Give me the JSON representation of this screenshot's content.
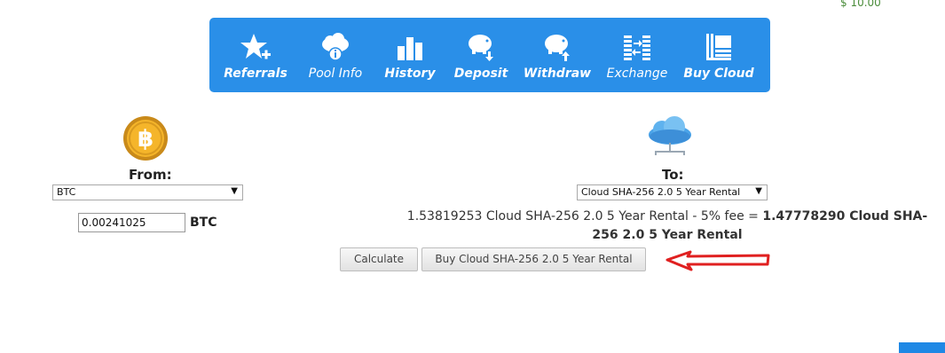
{
  "balance": "$ 10.00",
  "nav": {
    "items": [
      {
        "label": "Referrals",
        "icon": "star-plus-icon"
      },
      {
        "label": "Pool Info",
        "icon": "cloud-info-icon"
      },
      {
        "label": "History",
        "icon": "bar-chart-icon"
      },
      {
        "label": "Deposit",
        "icon": "piggy-bank-down-icon"
      },
      {
        "label": "Withdraw",
        "icon": "piggy-bank-up-icon"
      },
      {
        "label": "Exchange",
        "icon": "exchange-coins-icon"
      },
      {
        "label": "Buy Cloud",
        "icon": "buy-cloud-icon"
      }
    ]
  },
  "from": {
    "label": "From:",
    "currency": "BTC",
    "amount": "0.00241025",
    "unit": "BTC",
    "icon": "bitcoin-coin-icon"
  },
  "to": {
    "label": "To:",
    "product": "Cloud SHA-256 2.0 5 Year Rental",
    "icon": "cloud-network-icon"
  },
  "result": {
    "prefix": "1.53819253 Cloud SHA-256 2.0 5 Year Rental - 5% fee = ",
    "total": "1.47778290 Cloud SHA-256 2.0 5 Year Rental"
  },
  "buttons": {
    "calculate": "Calculate",
    "buy": "Buy Cloud SHA-256 2.0 5 Year Rental"
  },
  "colors": {
    "nav_bg": "#2a8fe8",
    "annotation_arrow": "#e02020",
    "balance_text": "#4a8c3a"
  }
}
